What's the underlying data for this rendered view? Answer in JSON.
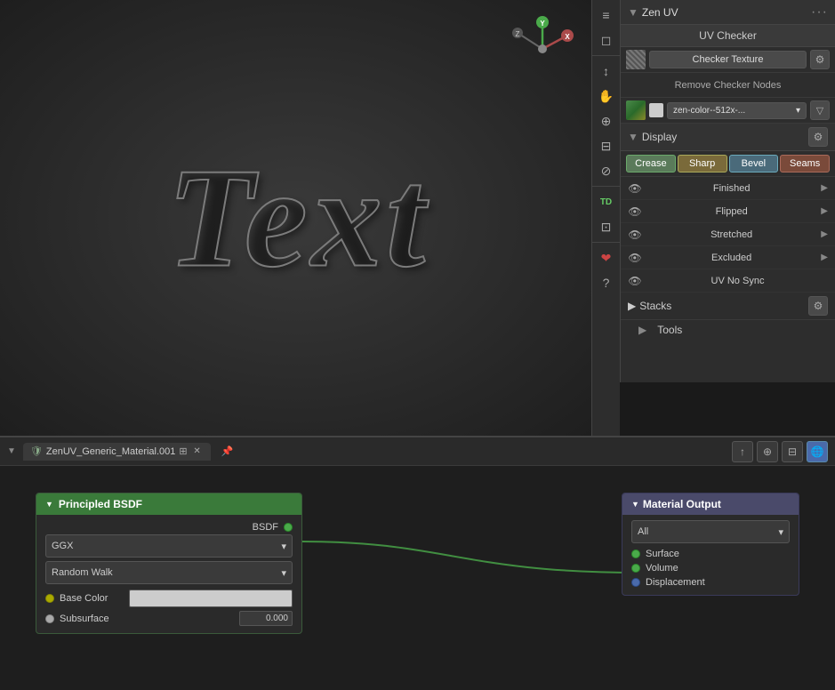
{
  "panel": {
    "title": "Zen UV",
    "dots": "···"
  },
  "uv_checker": {
    "section_label": "UV Checker",
    "checker_texture_label": "Checker Texture",
    "remove_checker_label": "Remove Checker Nodes",
    "texture_name": "zen-color--512x-...",
    "display_label": "Display"
  },
  "display_tabs": [
    {
      "id": "crease",
      "label": "Crease",
      "active": true
    },
    {
      "id": "sharp",
      "label": "Sharp",
      "active": false
    },
    {
      "id": "bevel",
      "label": "Bevel",
      "active": false
    },
    {
      "id": "seams",
      "label": "Seams",
      "active": false
    }
  ],
  "display_items": [
    {
      "label": "Finished"
    },
    {
      "label": "Flipped"
    },
    {
      "label": "Stretched"
    },
    {
      "label": "Excluded"
    },
    {
      "label": "UV No Sync"
    }
  ],
  "stacks": {
    "label": "Stacks"
  },
  "tools": {
    "label": "Tools"
  },
  "node_editor": {
    "tab_label": "ZenUV_Generic_Material.001",
    "principled_header": "Principled BSDF",
    "principled_output": "BSDF",
    "ggx_label": "GGX",
    "random_walk_label": "Random Walk",
    "base_color_label": "Base Color",
    "subsurface_label": "Subsurface",
    "subsurface_value": "0.000",
    "material_header": "Material Output",
    "material_target": "All",
    "surface_label": "Surface",
    "volume_label": "Volume",
    "displacement_label": "Displacement"
  },
  "viewport_text": "Text",
  "toolbar": {
    "icons": [
      "≡",
      "⊞",
      "↕",
      "✋",
      "⊕",
      "🎬",
      "⊟",
      "⊘",
      "TD",
      "⊡",
      "❤",
      "?"
    ]
  }
}
